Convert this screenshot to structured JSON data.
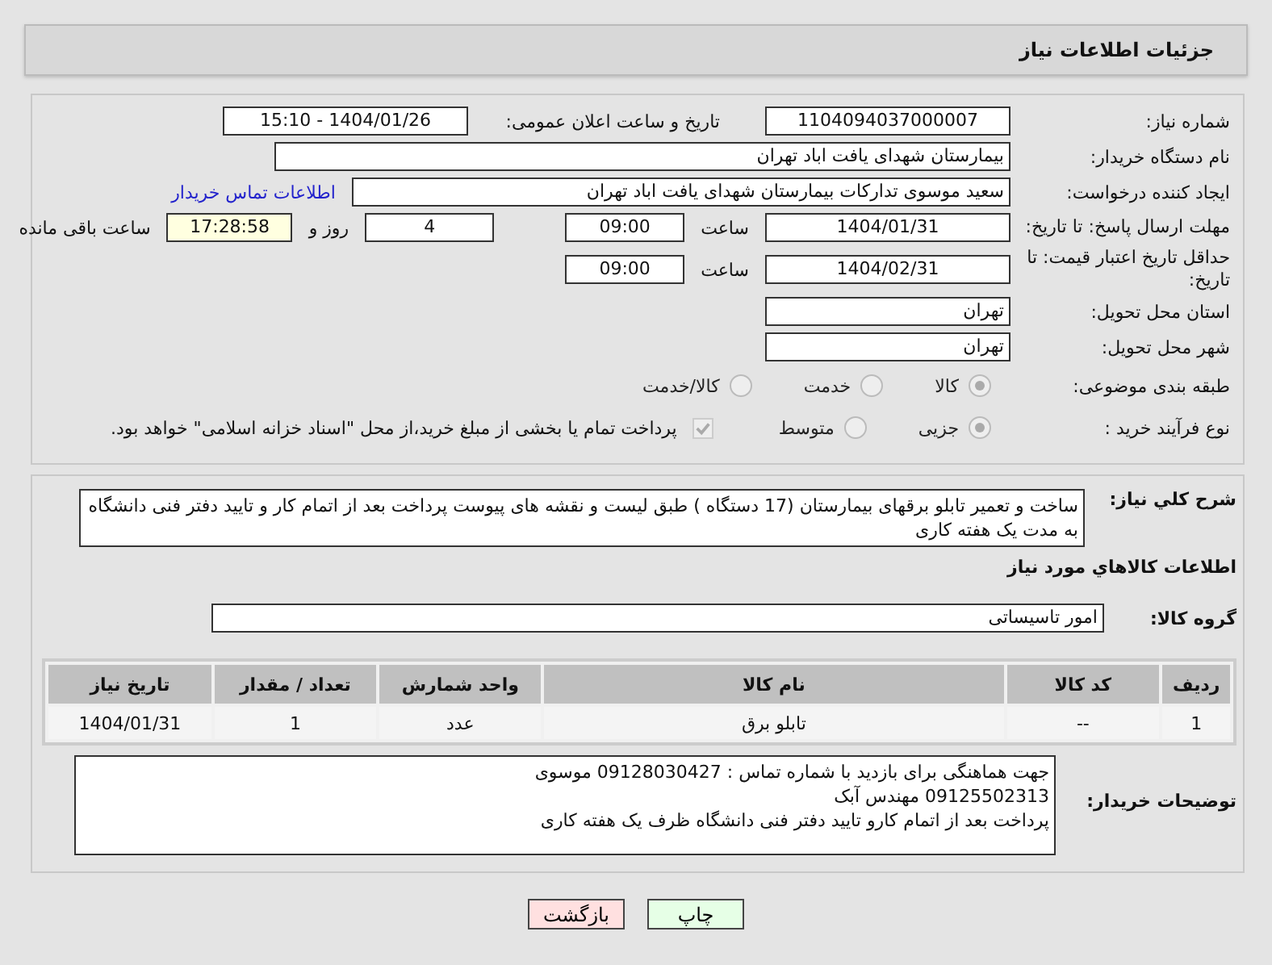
{
  "header": {
    "title": "جزئیات اطلاعات نیاز"
  },
  "need_number": {
    "label": "شماره نیاز:",
    "value": "1104094037000007"
  },
  "announce": {
    "label": "تاریخ و ساعت اعلان عمومی:",
    "value": "1404/01/26 - 15:10"
  },
  "buyer_org": {
    "label": "نام دستگاه خریدار:",
    "value": "بیمارستان شهدای یافت اباد تهران"
  },
  "requester": {
    "label": "ایجاد کننده درخواست:",
    "value": "سعید موسوی تدارکات بیمارستان شهدای یافت اباد تهران",
    "link": "اطلاعات تماس خریدار"
  },
  "deadline": {
    "label": "مهلت ارسال پاسخ: تا تاریخ:",
    "date": "1404/01/31",
    "time_label": "ساعت",
    "time": "09:00",
    "days": "4",
    "days_label": "روز و",
    "remaining": "17:28:58",
    "remaining_label": "ساعت باقی مانده"
  },
  "validity": {
    "label": "حداقل تاریخ اعتبار قیمت: تا تاریخ:",
    "date": "1404/02/31",
    "time_label": "ساعت",
    "time": "09:00"
  },
  "province": {
    "label": "استان محل تحویل:",
    "value": "تهران"
  },
  "city": {
    "label": "شهر محل تحویل:",
    "value": "تهران"
  },
  "category": {
    "label": "طبقه بندی موضوعی:",
    "options": [
      {
        "label": "کالا",
        "selected": true
      },
      {
        "label": "خدمت",
        "selected": false
      },
      {
        "label": "کالا/خدمت",
        "selected": false
      }
    ]
  },
  "process": {
    "label": "نوع فرآیند خرید :",
    "options": [
      {
        "label": "جزیی",
        "selected": true
      },
      {
        "label": "متوسط",
        "selected": false
      }
    ],
    "treasury": {
      "checked": true,
      "label": "پرداخت تمام یا بخشی از مبلغ خرید،از محل \"اسناد خزانه اسلامی\" خواهد بود."
    }
  },
  "description": {
    "label": "شرح کلي نياز:",
    "value": "ساخت و تعمیر تابلو برقهای بیمارستان (17 دستگاه ) طبق لیست و نقشه های پیوست   پرداخت بعد از اتمام کار و تایید دفتر فنی دانشگاه به مدت یک هفته کاری"
  },
  "goods_heading": "اطلاعات كالاهاي مورد نياز",
  "goods_group": {
    "label": "گروه کالا:",
    "value": "امور تاسیساتی"
  },
  "table": {
    "columns": [
      "ردیف",
      "کد کالا",
      "نام کالا",
      "واحد شمارش",
      "تعداد / مقدار",
      "تاریخ نیاز"
    ],
    "rows": [
      [
        "1",
        "--",
        "تابلو برق",
        "عدد",
        "1",
        "1404/01/31"
      ]
    ]
  },
  "buyer_notes": {
    "label": "توضیحات خریدار:",
    "lines": [
      "جهت هماهنگی  برای بازدید  با شماره تماس :   09128030427 موسوی",
      "09125502313 مهندس آبک",
      "پرداخت بعد از اتمام کارو تایید دفتر فنی دانشگاه ظرف یک هفته کاری"
    ]
  },
  "buttons": [
    {
      "label": "چاپ",
      "kind": "print"
    },
    {
      "label": "بازگشت",
      "kind": "back"
    }
  ]
}
